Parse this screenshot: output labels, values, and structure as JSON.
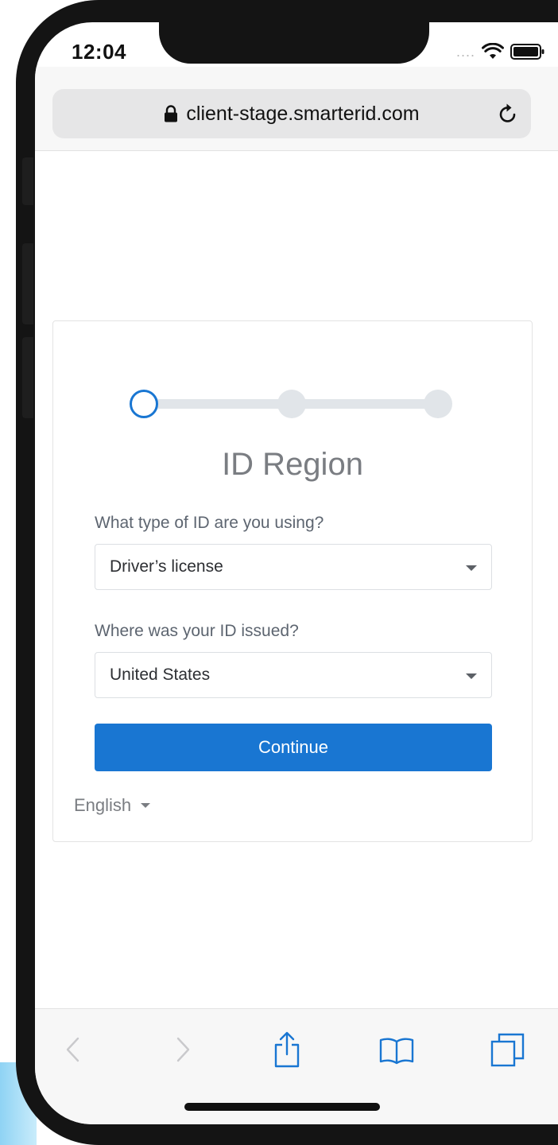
{
  "status_bar": {
    "time": "12:04",
    "signal": "...."
  },
  "browser": {
    "url": "client-stage.smarterid.com",
    "icons": [
      "lock-icon",
      "reload-icon",
      "back-icon",
      "forward-icon",
      "share-icon",
      "bookmarks-icon",
      "tabs-icon"
    ]
  },
  "form": {
    "progress": {
      "steps": 3,
      "current_step": 1
    },
    "title": "ID Region",
    "id_type": {
      "label": "What type of ID are you using?",
      "value": "Driver’s license"
    },
    "issued": {
      "label": "Where was your ID issued?",
      "value": "United States"
    },
    "continue_label": "Continue",
    "language": "English"
  },
  "colors": {
    "accent": "#1976d2",
    "step_inactive": "#e1e5e9",
    "chrome_bg": "#f7f7f7",
    "phone_frame": "#141414"
  }
}
